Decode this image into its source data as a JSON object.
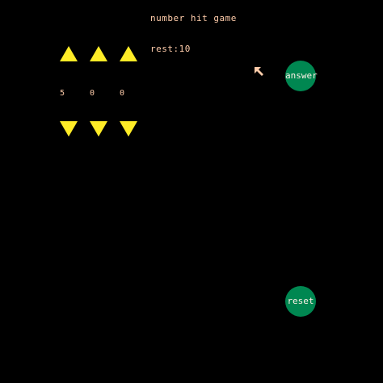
{
  "game": {
    "title": "number hit game",
    "rest_label": "rest:10",
    "digits": [
      "5",
      "0",
      "0"
    ],
    "buttons": {
      "answer": "answer",
      "reset": "reset"
    },
    "icons": {
      "up_arrow": "triangle-up",
      "down_arrow": "triangle-down",
      "cursor": "mouse-pointer"
    },
    "colors": {
      "background": "#000000",
      "text": "#FFCCAA",
      "arrow": "#FFEC27",
      "button": "#008751",
      "button_text": "#FFF1E8"
    }
  }
}
